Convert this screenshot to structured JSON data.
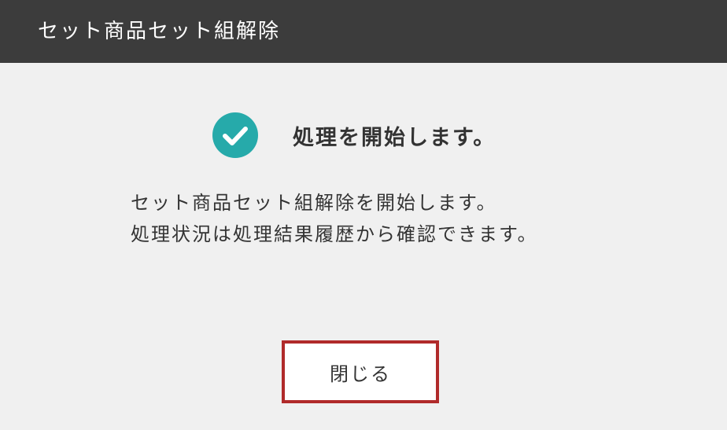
{
  "dialog": {
    "title": "セット商品セット組解除",
    "status": {
      "icon": "check-circle-icon",
      "text": "処理を開始します。"
    },
    "message": {
      "line1": "セット商品セット組解除を開始します。",
      "line2": "処理状況は処理結果履歴から確認できます。"
    },
    "close_label": "閉じる"
  },
  "colors": {
    "titlebar_bg": "#3c3c3c",
    "background": "#f0f0f0",
    "check_icon": "#26aaaa",
    "button_border": "#b02a2a"
  }
}
